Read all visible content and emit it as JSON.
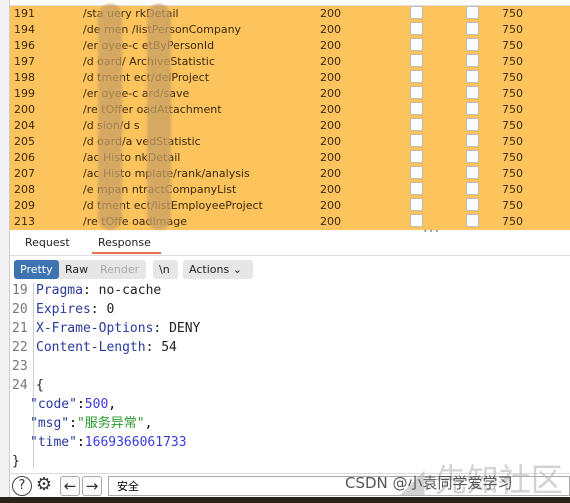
{
  "table": {
    "rows": [
      {
        "id": "191",
        "path": "/sta      uery    rkDetail",
        "status": "200",
        "length": "750"
      },
      {
        "id": "194",
        "path": "/de      men      /listPersonCompany",
        "status": "200",
        "length": "750"
      },
      {
        "id": "196",
        "path": "/er      oyee-c      etByPersonId",
        "status": "200",
        "length": "750"
      },
      {
        "id": "197",
        "path": "/d      oard/       ArchiveStatistic",
        "status": "200",
        "length": "750"
      },
      {
        "id": "198",
        "path": "/d      tment       ect/delProject",
        "status": "200",
        "length": "750"
      },
      {
        "id": "199",
        "path": "/er      oyee-c      ard/save",
        "status": "200",
        "length": "750"
      },
      {
        "id": "200",
        "path": "/re      tOffer      oadAttachment",
        "status": "200",
        "length": "750"
      },
      {
        "id": "204",
        "path": "/d      sion/d      s",
        "status": "200",
        "length": "750"
      },
      {
        "id": "205",
        "path": "/d      oard/a      vedStatistic",
        "status": "200",
        "length": "750"
      },
      {
        "id": "206",
        "path": "/ac      Histo      nkDetail",
        "status": "200",
        "length": "750"
      },
      {
        "id": "207",
        "path": "/ac      Histo      mplate/rank/analysis",
        "status": "200",
        "length": "750"
      },
      {
        "id": "208",
        "path": "/e      mpan      ntractCompanyList",
        "status": "200",
        "length": "750"
      },
      {
        "id": "209",
        "path": "/d      tment      ect/listEmployeeProject",
        "status": "200",
        "length": "750"
      },
      {
        "id": "213",
        "path": "/re      tOffe      oadImage",
        "status": "200",
        "length": "750"
      }
    ],
    "highlight_color": "#fdc35c"
  },
  "tabs": {
    "request": "Request",
    "response": "Response",
    "active": "response"
  },
  "toolbar": {
    "pretty": "Pretty",
    "raw": "Raw",
    "render": "Render",
    "newline": "\\n",
    "actions": "Actions"
  },
  "code": [
    {
      "n": "19",
      "key": "Pragma",
      "val": "no-cache"
    },
    {
      "n": "20",
      "key": "Expires",
      "val": "0"
    },
    {
      "n": "21",
      "key": "X-Frame-Options",
      "val": "DENY"
    },
    {
      "n": "22",
      "key": "Content-Length",
      "val": "54"
    },
    {
      "n": "23"
    },
    {
      "n": "24",
      "brace": "{"
    }
  ],
  "json": {
    "code_key": "\"code\"",
    "code_val": "500",
    "msg_key": "\"msg\"",
    "msg_val": "\"服务异常\"",
    "time_key": "\"time\"",
    "time_val": "1669366061733",
    "close": "}"
  },
  "bottom": {
    "search_value": "安全"
  },
  "watermark": {
    "csdn": "CSDN @小袁同学爱学习",
    "xz": "先知社区"
  }
}
